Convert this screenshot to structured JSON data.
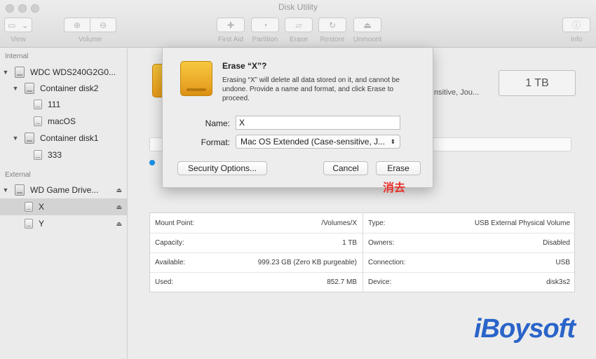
{
  "window": {
    "title": "Disk Utility"
  },
  "toolbar": {
    "view_label": "View",
    "volume_label": "Volume",
    "first_aid_label": "First Aid",
    "partition_label": "Partition",
    "erase_label": "Erase",
    "restore_label": "Restore",
    "unmount_label": "Unmount",
    "info_label": "Info"
  },
  "sidebar": {
    "internal_header": "Internal",
    "external_header": "External",
    "items": [
      {
        "label": "WDC WDS240G2G0..."
      },
      {
        "label": "Container disk2"
      },
      {
        "label": "111"
      },
      {
        "label": "macOS"
      },
      {
        "label": "Container disk1"
      },
      {
        "label": "333"
      },
      {
        "label": "WD Game Drive..."
      },
      {
        "label": "X"
      },
      {
        "label": "Y"
      }
    ]
  },
  "main": {
    "format_partial": "nsitive, Jou...",
    "size": "1 TB",
    "info": [
      {
        "label": "Mount Point:",
        "value": "/Volumes/X"
      },
      {
        "label": "Type:",
        "value": "USB External Physical Volume"
      },
      {
        "label": "Capacity:",
        "value": "1 TB"
      },
      {
        "label": "Owners:",
        "value": "Disabled"
      },
      {
        "label": "Available:",
        "value": "999.23 GB (Zero KB purgeable)"
      },
      {
        "label": "Connection:",
        "value": "USB"
      },
      {
        "label": "Used:",
        "value": "852.7 MB"
      },
      {
        "label": "Device:",
        "value": "disk3s2"
      }
    ]
  },
  "dialog": {
    "title": "Erase “X”?",
    "message": "Erasing “X” will delete all data stored on it, and cannot be undone. Provide a name and format, and click Erase to proceed.",
    "name_label": "Name:",
    "name_value": "X",
    "format_label": "Format:",
    "format_value": "Mac OS Extended (Case-sensitive, J...",
    "security_button": "Security Options...",
    "cancel_button": "Cancel",
    "erase_button": "Erase"
  },
  "annotation": "消去",
  "watermark": "iBoysoft",
  "colors": {
    "accent": "#1a8fe6",
    "annotation": "#e8302a",
    "drive": "#f0b22f",
    "watermark": "#2a64c9"
  },
  "icons": [
    "disk-icon",
    "volume-icon",
    "eject-icon",
    "disclosure-triangle-icon",
    "external-drive-icon"
  ]
}
